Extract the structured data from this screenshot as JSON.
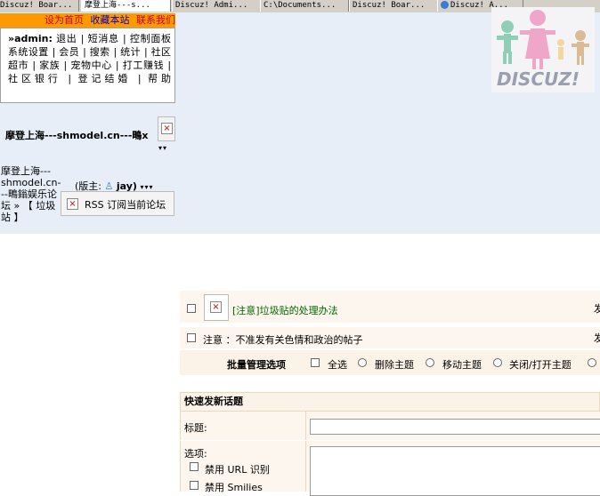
{
  "taskbar": {
    "tabs": [
      {
        "label": "Discuz! Boar..."
      },
      {
        "label": "摩登上海---s..."
      },
      {
        "label": "Discuz! Admi..."
      },
      {
        "label": "C:\\Documents..."
      },
      {
        "label": "Discuz! Boar..."
      },
      {
        "label": "Discuz! A..."
      }
    ]
  },
  "header": {
    "links": [
      "设为首页",
      "收藏本站",
      "联系我们"
    ],
    "logo_text": "DISCUZ!"
  },
  "usermenu": {
    "prefix": "»",
    "username": "admin:",
    "items": [
      "退出",
      "短消息",
      "控制面板",
      "系统设置",
      "会员",
      "搜索",
      "统计",
      "社区超市",
      "家族",
      "宠物中心",
      "打工赚钱",
      "社区银行",
      "登记结婚",
      "帮助"
    ]
  },
  "forum": {
    "title": "摩登上海---shmodel.cn---鴫ⅹ",
    "breadcrumb": "摩登上海---shmodel.cn---鴫鎓娱乐论坛 » 【 垃圾站 】",
    "moderator_label": "(版主:",
    "moderator_name": "jay)",
    "rss_label": "RSS 订阅当前论坛"
  },
  "threads": {
    "rows": [
      {
        "title": "[注意]垃圾贴的处理办法",
        "trail": "发"
      },
      {
        "title": "注意 ：不准发有关色情和政治的帖子",
        "trail": "发"
      }
    ],
    "batch": {
      "label": "批量管理选项",
      "select_all": "全选",
      "options": [
        "删除主题",
        "移动主题",
        "关闭/打开主题"
      ]
    }
  },
  "quickpost": {
    "heading": "快速发新话题",
    "subject_label": "标题:",
    "options_label": "选项:",
    "disable_url": "禁用 URL 识别",
    "disable_smilies": "禁用 Smilies"
  }
}
